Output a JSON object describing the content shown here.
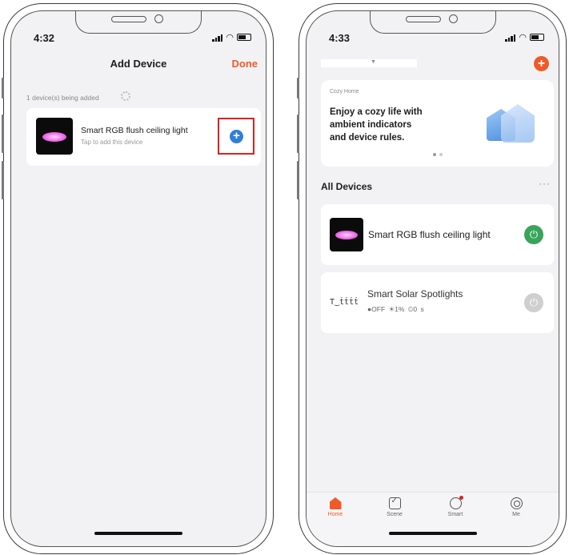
{
  "left_screen": {
    "status_time": "4:32",
    "title": "Add Device",
    "done_label": "Done",
    "adding_status": "1 device(s) being added",
    "device": {
      "name": "Smart RGB flush ceiling light",
      "subtitle": "Tap to add this device",
      "add_icon": "plus-circle-icon"
    }
  },
  "right_screen": {
    "status_time": "4:33",
    "add_icon": "plus-circle-icon",
    "banner": {
      "kicker": "Cozy Home",
      "line1": "Enjoy a cozy life with",
      "line2": "ambient indicators",
      "line3": "and device rules."
    },
    "section_title": "All Devices",
    "more_label": "···",
    "devices": [
      {
        "name": "Smart RGB flush ceiling light",
        "power_on": true
      },
      {
        "name": "Smart Solar Spotlights",
        "power_on": false,
        "stats": "●OFF ☀1% ⏲0 s"
      }
    ],
    "tabs": [
      {
        "label": "Home",
        "icon": "home-icon",
        "active": true
      },
      {
        "label": "Scene",
        "icon": "scene-icon",
        "active": false
      },
      {
        "label": "Smart",
        "icon": "smart-icon",
        "active": false
      },
      {
        "label": "Me",
        "icon": "me-icon",
        "active": false
      }
    ]
  },
  "colors": {
    "accent": "#f05a28",
    "power_on": "#3aa45c",
    "power_off": "#cfcfcf",
    "highlight_box": "#e02020",
    "add_button": "#2f7fd8"
  }
}
